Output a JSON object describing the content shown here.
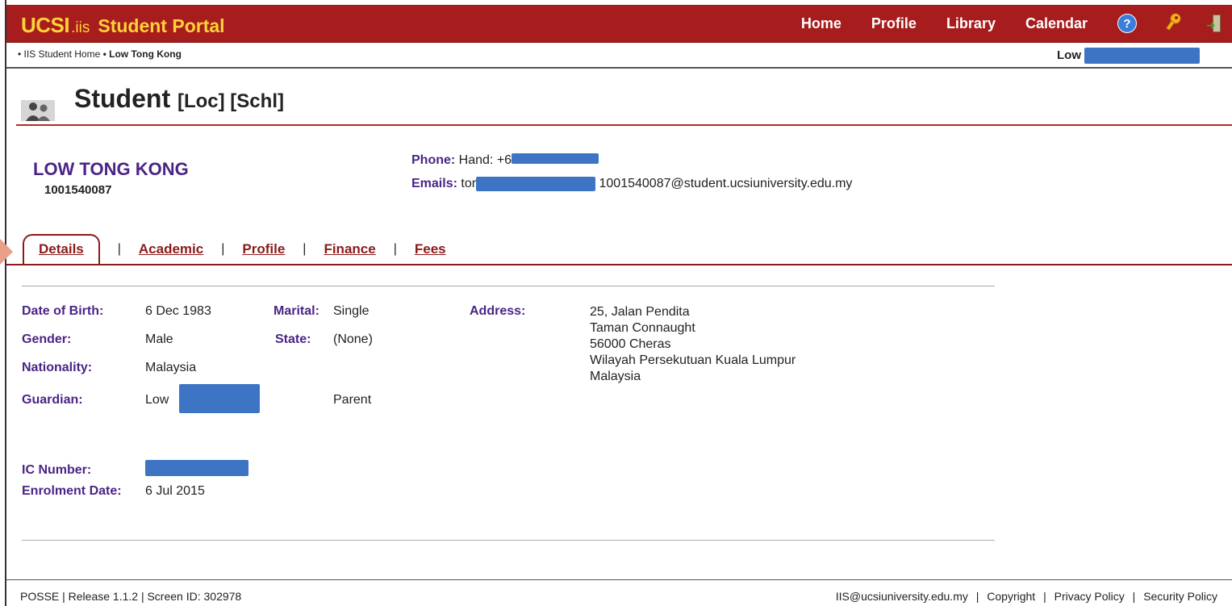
{
  "header": {
    "brand": {
      "ucsi": "UCSI",
      "iis": ".iis",
      "portal": "Student Portal"
    },
    "nav": [
      "Home",
      "Profile",
      "Library",
      "Calendar"
    ],
    "help_glyph": "?",
    "icons": [
      "help-icon",
      "key-icon",
      "exit-icon"
    ],
    "colors": {
      "bar": "#a71c1c",
      "brand_text": "#ffd23a"
    }
  },
  "breadcrumb": {
    "items": [
      "• IIS Student Home",
      "• Low Tong Kong"
    ],
    "user_prefix": "Low"
  },
  "page": {
    "title": "Student",
    "title_suffix": "[Loc] [Schl]"
  },
  "student": {
    "name": "LOW TONG KONG",
    "id": "1001540087",
    "phone_label": "Phone:",
    "phone_value": "Hand: +6",
    "emails_label": "Emails:",
    "email_prefix": "tor",
    "email_second": "1001540087@student.ucsiuniversity.edu.my"
  },
  "tabs": [
    {
      "label": "Details",
      "active": true
    },
    {
      "label": "Academic",
      "active": false
    },
    {
      "label": "Profile",
      "active": false
    },
    {
      "label": "Finance",
      "active": false
    },
    {
      "label": "Fees",
      "active": false
    }
  ],
  "tab_separator": "|",
  "details": {
    "dob_label": "Date of Birth:",
    "dob": "6 Dec 1983",
    "gender_label": "Gender:",
    "gender": "Male",
    "nationality_label": "Nationality:",
    "nationality": "Malaysia",
    "guardian_label": "Guardian:",
    "guardian": "Low",
    "guardian_relation": "Parent",
    "marital_label": "Marital:",
    "marital": "Single",
    "state_label": "State:",
    "state": "(None)",
    "address_label": "Address:",
    "address_lines": [
      "25, Jalan Pendita",
      "Taman Connaught",
      "56000 Cheras",
      "Wilayah Persekutuan Kuala Lumpur",
      "Malaysia"
    ],
    "ic_label": "IC Number:",
    "enrolment_label": "Enrolment Date:",
    "enrolment": "6 Jul 2015"
  },
  "footer": {
    "left": "POSSE | Release 1.1.2 | Screen ID: 302978",
    "links": [
      "IIS@ucsiuniversity.edu.my",
      "Copyright",
      "Privacy Policy",
      "Security Policy"
    ],
    "separator": "|"
  }
}
